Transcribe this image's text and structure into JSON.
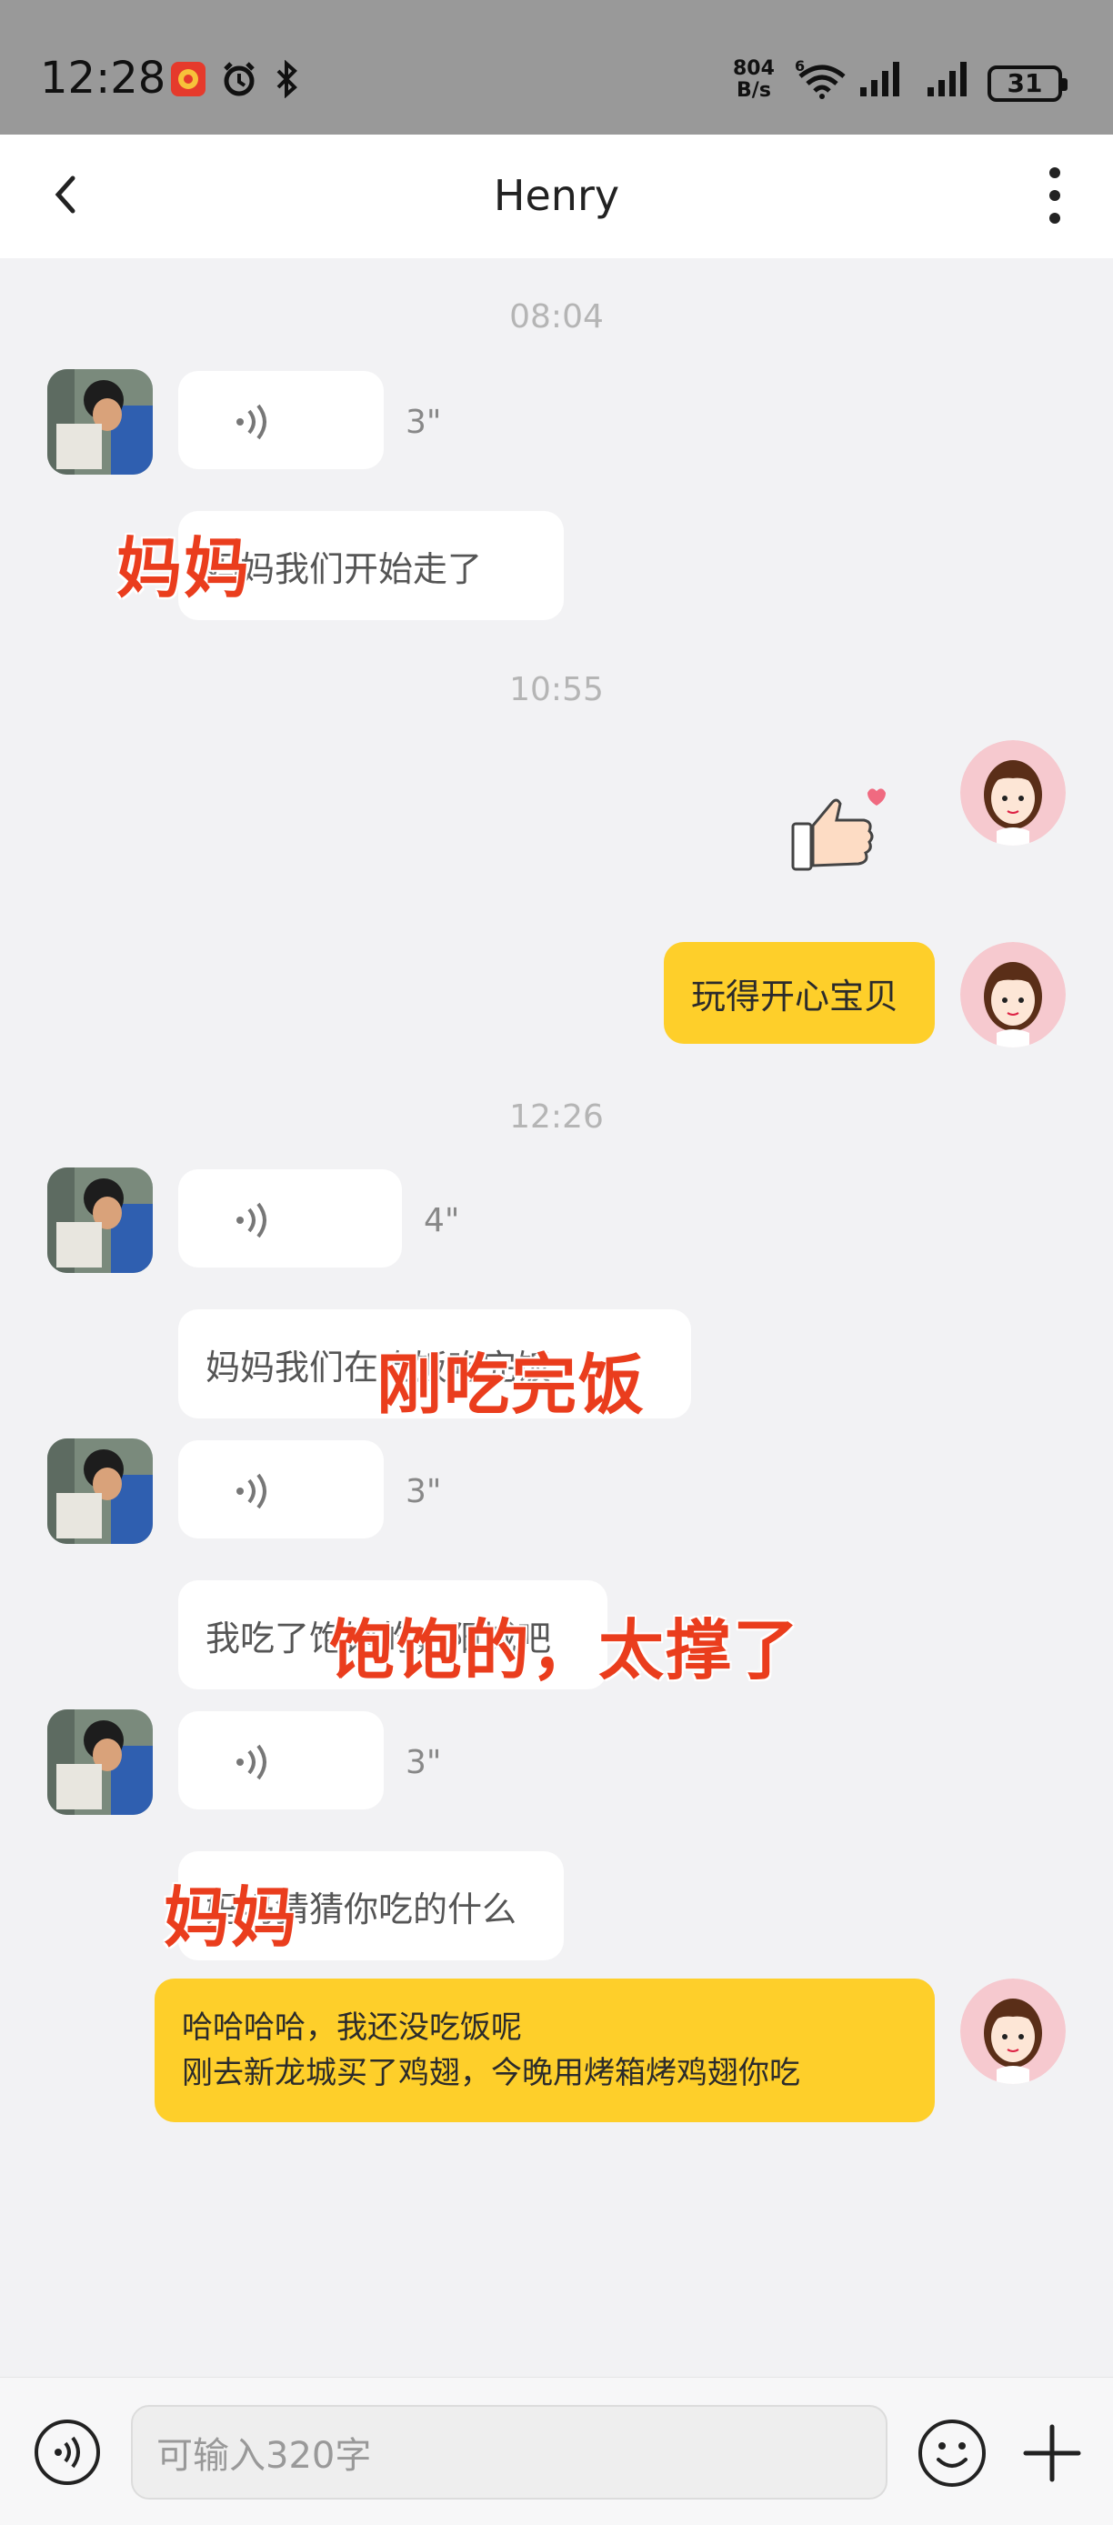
{
  "status": {
    "time": "12:28",
    "net_speed_value": "804",
    "net_speed_unit": "B/s",
    "battery": "31"
  },
  "header": {
    "title": "Henry"
  },
  "timestamps": [
    "08:04",
    "10:55",
    "12:26"
  ],
  "messages": {
    "m1_voice_duration": "3\"",
    "m2_text": "妈妈我们开始走了",
    "m3_text": "玩得开心宝贝",
    "m4_voice_duration": "4\"",
    "m5_text": "妈妈我们在吃饭吃完饭",
    "m6_voice_duration": "3\"",
    "m7_text": "我吃了饱饱的，阳城吧",
    "m8_voice_duration": "3\"",
    "m9_text": "妈妈猜猜你吃的什么",
    "m10_line1": "哈哈哈哈，我还没吃饭呢",
    "m10_line2": "刚去新龙城买了鸡翅，今晚用烤箱烤鸡翅你吃"
  },
  "overlays": {
    "o1": "妈妈",
    "o2": "刚吃完饭",
    "o3": "饱饱的，太撑了",
    "o4": "妈妈"
  },
  "input": {
    "placeholder": "可输入320字"
  },
  "colors": {
    "my_bubble": "#fecf2a",
    "overlay_text": "#ea3d1d",
    "status_bar": "#999999"
  },
  "icons": [
    "back-icon",
    "more-icon",
    "voice-wave-icon",
    "thumbs-up-heart-sticker",
    "voice-toggle-icon",
    "emoji-icon",
    "plus-icon"
  ]
}
